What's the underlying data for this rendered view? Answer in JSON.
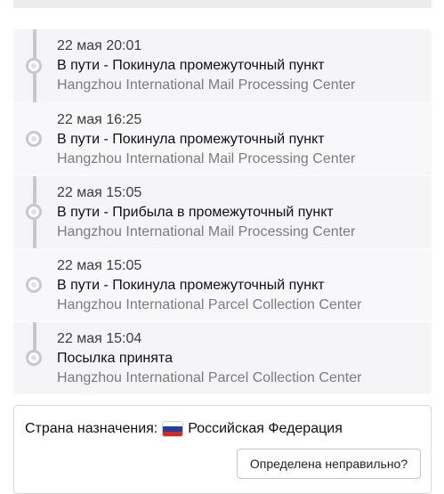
{
  "tracking": {
    "events": [
      {
        "date": "22 мая 20:01",
        "status": "В пути - Покинула промежуточный пункт",
        "location": "Hangzhou International Mail Processing Center"
      },
      {
        "date": "22 мая 16:25",
        "status": "В пути - Покинула промежуточный пункт",
        "location": "Hangzhou International Mail Processing Center"
      },
      {
        "date": "22 мая 15:05",
        "status": "В пути - Прибыла в промежуточный пункт",
        "location": "Hangzhou International Mail Processing Center"
      },
      {
        "date": "22 мая 15:05",
        "status": "В пути - Покинула промежуточный пункт",
        "location": "Hangzhou International Parcel Collection Center"
      },
      {
        "date": "22 мая 15:04",
        "status": "Посылка принята",
        "location": "Hangzhou International Parcel Collection Center"
      }
    ]
  },
  "destination": {
    "label": "Страна назначения:",
    "country": "Российская Федерация",
    "flag_icon": "russia-flag-icon",
    "flag_colors": [
      "#ffffff",
      "#1c3fa8",
      "#d52b1e"
    ],
    "wrong_button_label": "Определена неправильно?"
  },
  "colors": {
    "timeline": "#c8c8cc",
    "card_background": "#f5f5f7",
    "secondary_text": "#7c7c80"
  }
}
